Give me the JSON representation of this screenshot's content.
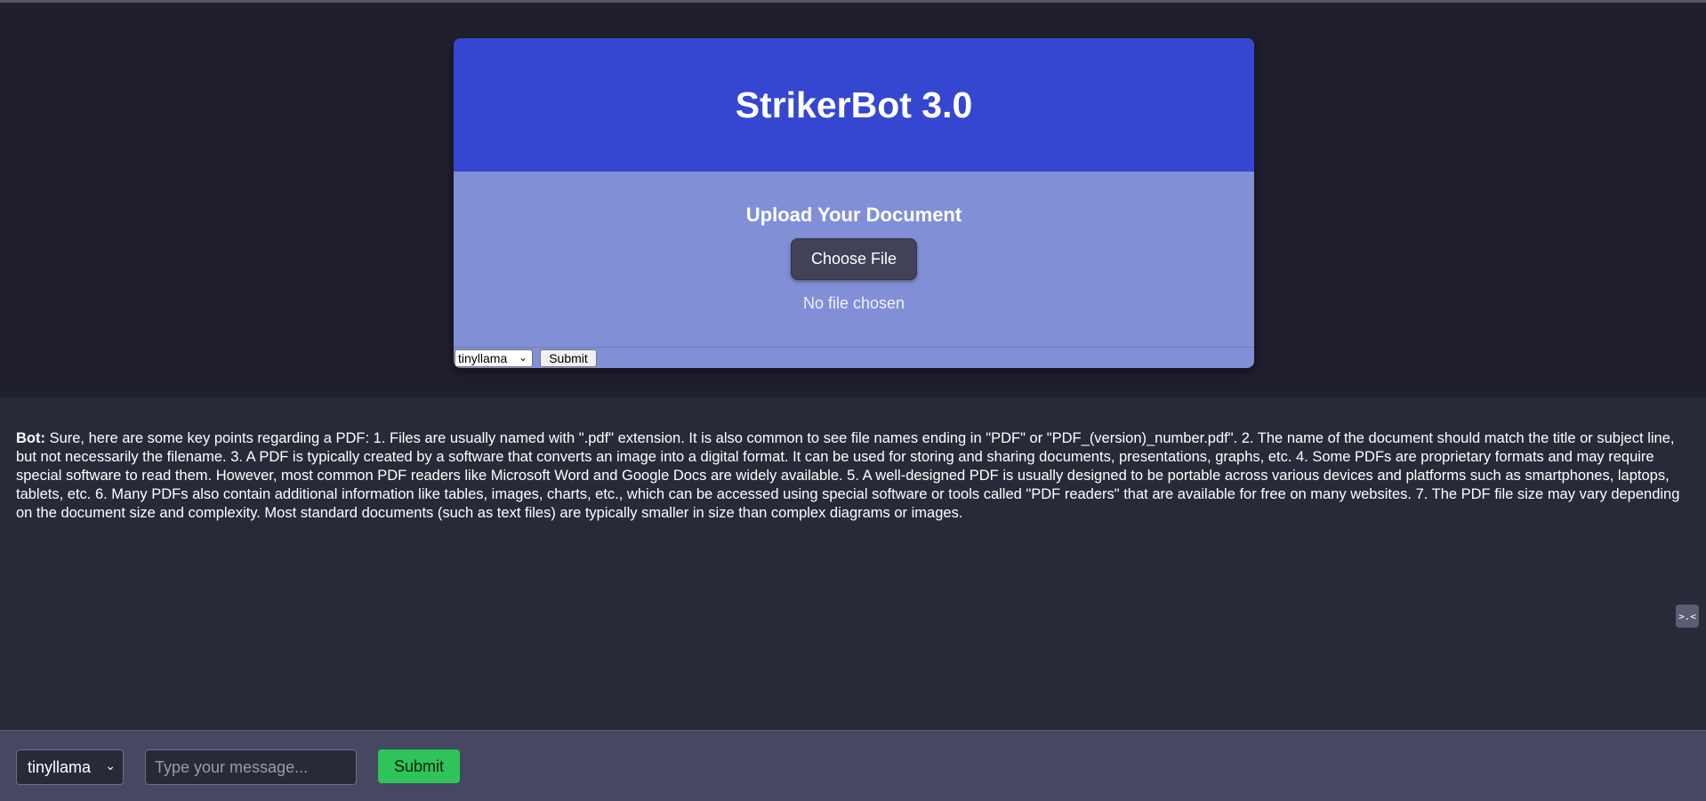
{
  "app": {
    "title": "StrikerBot 3.0"
  },
  "upload": {
    "heading": "Upload Your Document",
    "choose_label": "Choose File",
    "file_status": "No file chosen",
    "model_value": "tinyllama",
    "submit_label": "Submit"
  },
  "chat": {
    "messages": [
      {
        "sender_label": "Bot:",
        "text": " Sure, here are some key points regarding a PDF: 1. Files are usually named with \".pdf\" extension. It is also common to see file names ending in \"PDF\" or \"PDF_(version)_number.pdf\". 2. The name of the document should match the title or subject line, but not necessarily the filename. 3. A PDF is typically created by a software that converts an image into a digital format. It can be used for storing and sharing documents, presentations, graphs, etc. 4. Some PDFs are proprietary formats and may require special software to read them. However, most common PDF readers like Microsoft Word and Google Docs are widely available. 5. A well-designed PDF is usually designed to be portable across various devices and platforms such as smartphones, laptops, tablets, etc. 6. Many PDFs also contain additional information like tables, images, charts, etc., which can be accessed using special software or tools called \"PDF readers\" that are available for free on many websites. 7. The PDF file size may vary depending on the document size and complexity. Most standard documents (such as text files) are typically smaller in size than complex diagrams or images."
      }
    ],
    "side_icon_glyph": ">.<"
  },
  "composer": {
    "model_value": "tinyllama",
    "placeholder": "Type your message...",
    "submit_label": "Submit"
  },
  "colors": {
    "header_bg": "#3547d1",
    "card_body_bg": "#8190d6",
    "page_bg": "#1f1f2e",
    "chat_bg": "#282a38",
    "bottom_bar_bg": "#454860",
    "submit_green": "#2ec45a"
  }
}
